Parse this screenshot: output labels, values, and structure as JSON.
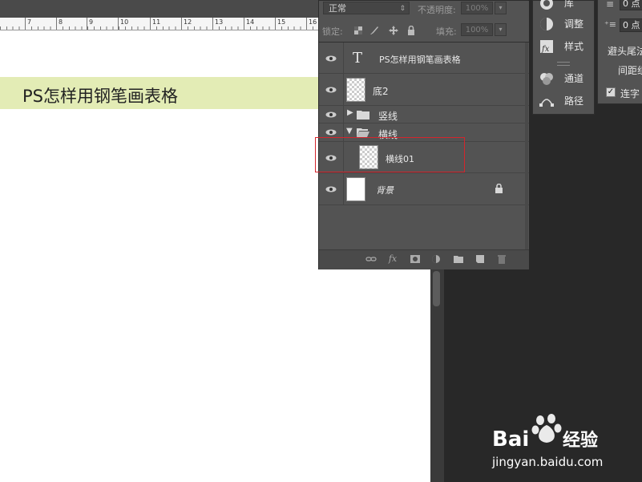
{
  "ruler": {
    "labels": [
      "7",
      "8",
      "9",
      "10",
      "11",
      "12",
      "13",
      "14",
      "15",
      "16"
    ]
  },
  "canvas": {
    "banner_text": "PS怎样用钢笔画表格",
    "banner_color": "#e3ecb5"
  },
  "layers_panel": {
    "blend_mode": "正常",
    "opacity_label": "不透明度:",
    "opacity_value": "100%",
    "lock_label": "锁定:",
    "fill_label": "填充:",
    "fill_value": "100%",
    "layers": [
      {
        "name": "PS怎样用钢笔画表格",
        "type": "text-layer"
      },
      {
        "name": "底2",
        "type": "pixel-layer"
      },
      {
        "name": "竖线",
        "type": "group-collapsed"
      },
      {
        "name": "横线",
        "type": "group-expanded"
      },
      {
        "name": "横线01",
        "type": "pixel-layer",
        "selected_highlight": true
      },
      {
        "name": "背景",
        "type": "background",
        "locked": true
      }
    ],
    "bottom_icons": [
      "link-icon",
      "fx-icon",
      "mask-icon",
      "adjustment-icon",
      "folder-icon",
      "new-layer-icon",
      "trash-icon"
    ],
    "highlight_color": "#d4252d"
  },
  "side_panel": {
    "items": [
      {
        "label": "库",
        "icon": "library-icon"
      },
      {
        "label": "调整",
        "icon": "adjustment-icon"
      },
      {
        "label": "样式",
        "icon": "styles-icon"
      },
      {
        "label": "通道",
        "icon": "channels-icon"
      },
      {
        "label": "路径",
        "icon": "paths-icon"
      }
    ]
  },
  "paragraph_panel": {
    "field1": "0 点",
    "field2": "0 点",
    "text1": "避头尾法",
    "text2": "间距组",
    "hyphen_label": "连字"
  },
  "watermark": {
    "text": "jingyan.baidu.com",
    "brand": "Baidu 经验"
  }
}
